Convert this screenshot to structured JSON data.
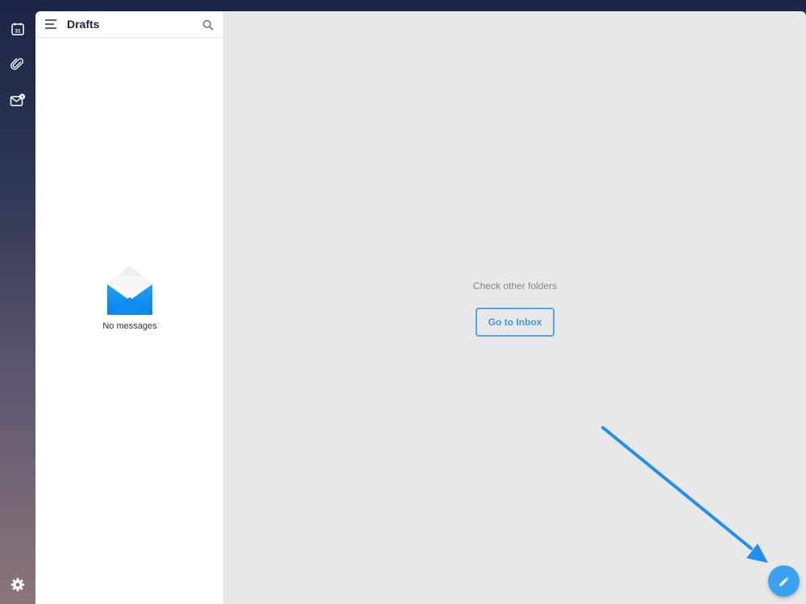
{
  "rail": {
    "calendar_day": "31",
    "icons": [
      "calendar-icon",
      "attachment-icon",
      "mail-badge-icon",
      "settings-icon"
    ]
  },
  "list": {
    "folder_title": "Drafts",
    "empty_text": "No messages"
  },
  "reading": {
    "hint": "Check other folders",
    "go_inbox_label": "Go to Inbox"
  },
  "colors": {
    "accent": "#3aa2f0",
    "annotation_arrow": "#1e90f0",
    "sidebar_top": "#1c2545",
    "sidebar_bottom": "#8a7679"
  }
}
